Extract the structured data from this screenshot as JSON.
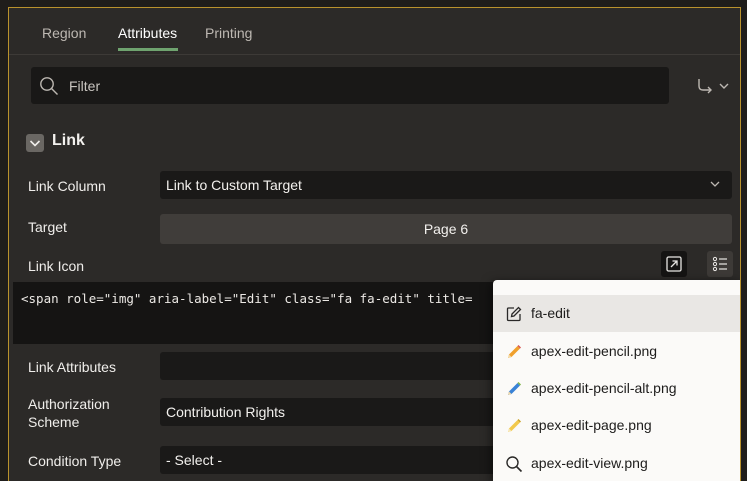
{
  "tabs": [
    {
      "label": "Region"
    },
    {
      "label": "Attributes"
    },
    {
      "label": "Printing"
    }
  ],
  "filter": {
    "placeholder": "Filter"
  },
  "section": {
    "title": "Link"
  },
  "rows": {
    "link_column": {
      "label": "Link Column",
      "value": "Link to Custom Target"
    },
    "target": {
      "label": "Target",
      "value": "Page 6"
    },
    "link_icon": {
      "label": "Link Icon",
      "code": "<span role=\"img\" aria-label=\"Edit\" class=\"fa fa-edit\" title="
    },
    "link_attributes": {
      "label": "Link Attributes",
      "value": ""
    },
    "authorization": {
      "label": "Authorization Scheme",
      "value": "Contribution Rights"
    },
    "condition_type": {
      "label": "Condition Type",
      "value": "- Select -"
    }
  },
  "icon_options": [
    {
      "label": "fa-edit",
      "icon": "edit-icon"
    },
    {
      "label": "apex-edit-pencil.png",
      "icon": "pencil-icon"
    },
    {
      "label": "apex-edit-pencil-alt.png",
      "icon": "pencil-alt-icon"
    },
    {
      "label": "apex-edit-page.png",
      "icon": "edit-page-icon"
    },
    {
      "label": "apex-edit-view.png",
      "icon": "magnifier-icon"
    }
  ],
  "colors": {
    "background": "#2c2a28",
    "field": "#1a1918",
    "accent": "#6fa36f",
    "border": "#b9922d",
    "popup": "#fbfaf8"
  }
}
